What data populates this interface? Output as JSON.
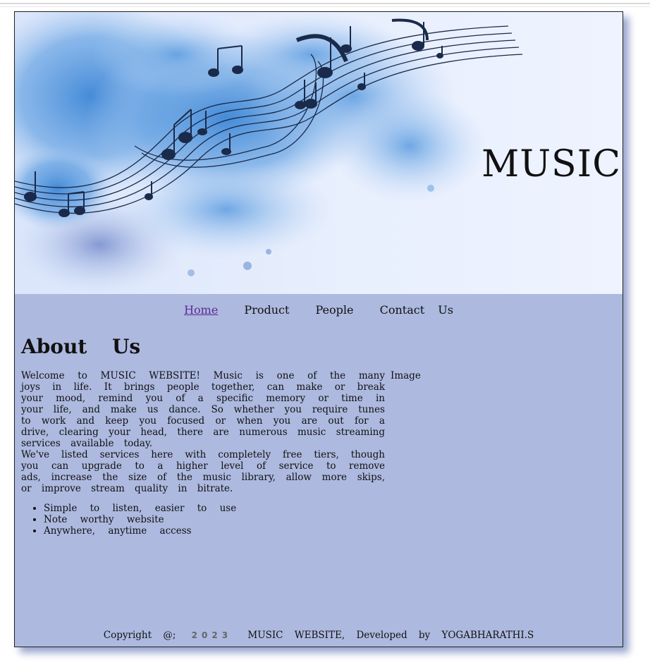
{
  "banner": {
    "title": "MUSIC"
  },
  "nav": {
    "items": [
      {
        "label": "Home",
        "active": true
      },
      {
        "label": "Product"
      },
      {
        "label": "People"
      },
      {
        "label": "Contact Us"
      }
    ]
  },
  "about": {
    "heading": "About Us",
    "paragraph_1": "Welcome to MUSIC WEBSITE! Music is one of the many joys in life. It brings people together, can make or break your mood, remind you of a specific memory or time in your life, and make us dance. So whether you require tunes to work and keep you focused or when you are out for a drive, clearing your head, there are numerous music streaming services available today.",
    "paragraph_2": "We've listed services here with completely free tiers, though you can upgrade to a higher level of service to remove ads, increase the size of the music library, allow more skips, or improve stream quality in bitrate.",
    "image_alt": "Image",
    "features": [
      "Simple to listen, easier to use",
      "Note worthy website",
      "Anywhere, anytime access"
    ]
  },
  "footer": {
    "prefix": "Copyright @;",
    "year": "2023",
    "suffix": "MUSIC WEBSITE, Developed by YOGABHARATHI.S"
  },
  "colors": {
    "page_bg": "#adb9df",
    "link_active": "#5c2b98",
    "accent_blue": "#4a90d9",
    "notes": "#1a2a4a"
  }
}
